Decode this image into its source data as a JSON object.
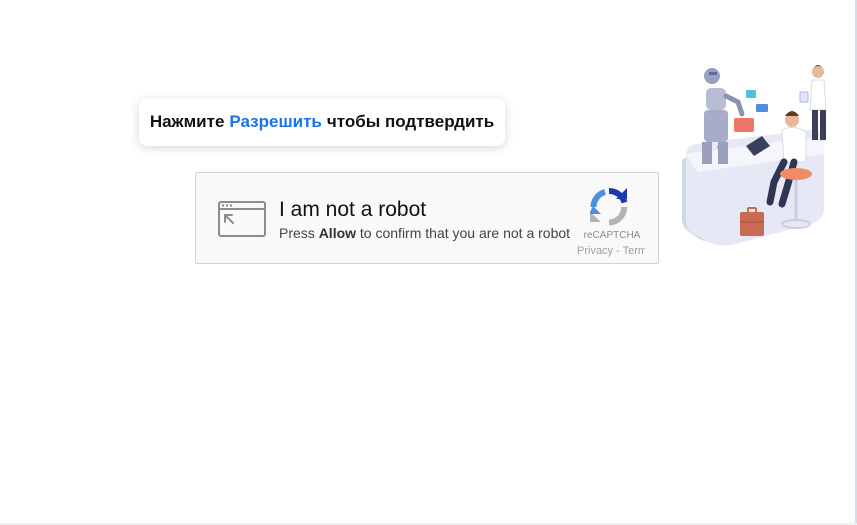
{
  "prompt": {
    "before": "Нажмите",
    "accent": "Разрешить",
    "after": "чтобы подтвердить",
    "accent_color": "#1a73e8"
  },
  "captcha": {
    "title": "I am not a robot",
    "subtitle_prefix": "Press",
    "subtitle_bold": "Allow",
    "subtitle_suffix": "to confirm that you are not a robot",
    "brand": "reCAPTCHA",
    "links": "Privacy - Terms",
    "icon": "browser-window-icon",
    "logo_icon": "recaptcha-logo-icon"
  },
  "illustration": {
    "icon": "office-robot-illustration"
  }
}
